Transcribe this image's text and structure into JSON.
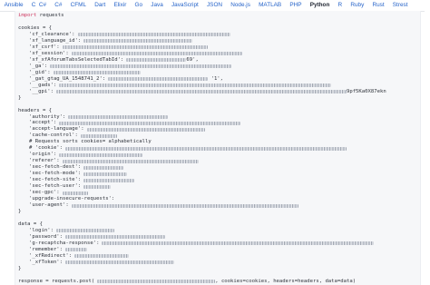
{
  "tabs": [
    {
      "label": "Ansible",
      "active": false
    },
    {
      "label": "C  C#",
      "active": false
    },
    {
      "label": "C#",
      "active": false
    },
    {
      "label": "CFML",
      "active": false
    },
    {
      "label": "Dart",
      "active": false
    },
    {
      "label": "Elixir",
      "active": false
    },
    {
      "label": "Go",
      "active": false
    },
    {
      "label": "Java",
      "active": false
    },
    {
      "label": "JavaScript",
      "active": false
    },
    {
      "label": "JSON",
      "active": false
    },
    {
      "label": "Node.js",
      "active": false
    },
    {
      "label": "MATLAB",
      "active": false
    },
    {
      "label": "PHP",
      "active": false
    },
    {
      "label": "Python",
      "active": true
    },
    {
      "label": "R",
      "active": false
    },
    {
      "label": "Ruby",
      "active": false
    },
    {
      "label": "Rust",
      "active": false
    },
    {
      "label": "Strest",
      "active": false
    }
  ],
  "code": {
    "import_kw": "import",
    "import_mod": " requests",
    "cookies_open": "cookies = {",
    "cookie_keys": [
      "'cf_clearance':",
      "'xf_language_id':",
      "'xf_csrf':",
      "'xf_session':",
      "'xf_xfAforumTabsSelectedTabId':",
      "'_ga':",
      "'_gid':",
      "'_gat_gtag_UA_1548741_2':",
      "'__gads':",
      "'__gpi':"
    ],
    "cookie_visible_tail": {
      "4": "69',",
      "7": " '1',",
      "9": "9pf5Ka0X87ekn"
    },
    "close": "}",
    "headers_open": "headers = {",
    "header_keys": [
      "'authority':",
      "'accept':",
      "'accept-language':",
      "'cache-control':",
      "# Requests sorts cookies= alphabetically",
      "# 'cookie':",
      "'origin':",
      "'referer':",
      "'sec-fetch-dest':",
      "'sec-fetch-mode':",
      "'sec-fetch-site':",
      "'sec-fetch-user':",
      "'sec-gpc':",
      "'upgrade-insecure-requests':",
      "'user-agent':"
    ],
    "data_open": "data = {",
    "data_keys": [
      "'login':",
      "'password':",
      "'g-recaptcha-response':",
      "'remember':",
      "'_xfRedirect':",
      "'_xfToken':"
    ],
    "response_line_prefix": "response = requests.post(",
    "response_line_suffix": ", cookies=cookies, headers=headers, data=data)"
  }
}
